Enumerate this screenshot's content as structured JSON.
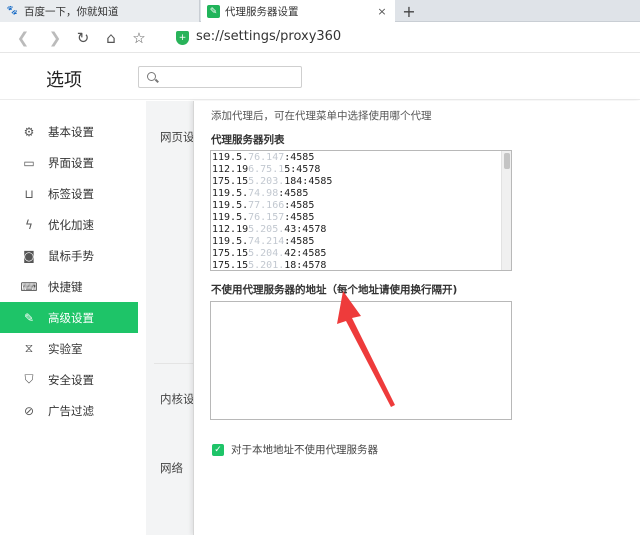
{
  "tabs": [
    {
      "title": "百度一下，你就知道",
      "icon": "baidu-paw-icon"
    },
    {
      "title": "代理服务器设置",
      "icon": "wrench-icon"
    }
  ],
  "tab_close": "×",
  "new_tab": "+",
  "address": {
    "url": "se://settings/proxy360"
  },
  "header": {
    "title": "选项",
    "search_placeholder": ""
  },
  "sidebar": {
    "items": [
      {
        "label": "基本设置",
        "icon": "gear-icon"
      },
      {
        "label": "界面设置",
        "icon": "window-icon"
      },
      {
        "label": "标签设置",
        "icon": "tab-icon"
      },
      {
        "label": "优化加速",
        "icon": "lightning-icon"
      },
      {
        "label": "鼠标手势",
        "icon": "mouse-icon"
      },
      {
        "label": "快捷键",
        "icon": "keyboard-icon"
      },
      {
        "label": "高级设置",
        "icon": "wrench-icon",
        "active": true
      },
      {
        "label": "实验室",
        "icon": "flask-icon"
      },
      {
        "label": "安全设置",
        "icon": "shield-icon"
      },
      {
        "label": "广告过滤",
        "icon": "block-icon"
      }
    ]
  },
  "sections": [
    "网页设",
    "内核设",
    "网络"
  ],
  "proxy_dialog": {
    "hint": "添加代理后，可在代理菜单中选择使用哪个代理",
    "list_label": "代理服务器列表",
    "list": [
      {
        "visible": "119.5.",
        "hidden": "76.147",
        "tail": ":4585"
      },
      {
        "visible": "112.19",
        "hidden": "6.75.1",
        "tail": "5:4578"
      },
      {
        "visible": "175.15",
        "hidden": "5.203.",
        "tail": "184:4585"
      },
      {
        "visible": "119.5.",
        "hidden": "74.98",
        "tail": ":4585"
      },
      {
        "visible": "119.5.",
        "hidden": "77.166",
        "tail": ":4585"
      },
      {
        "visible": "119.5.",
        "hidden": "76.157",
        "tail": ":4585"
      },
      {
        "visible": "112.19",
        "hidden": "5.205.",
        "tail": "43:4578"
      },
      {
        "visible": "119.5.",
        "hidden": "74.214",
        "tail": ":4585"
      },
      {
        "visible": "175.15",
        "hidden": "5.204.",
        "tail": "42:4585"
      },
      {
        "visible": "175.15",
        "hidden": "5.201.",
        "tail": "18:4578"
      }
    ],
    "bypass_label": "不使用代理服务器的地址（每个地址请使用换行隔开)",
    "bypass_value": "",
    "local_bypass_label": "对于本地地址不使用代理服务器",
    "local_bypass_checked": true
  },
  "colors": {
    "accent": "#1ec468",
    "annotation": "#ee3b3b"
  }
}
